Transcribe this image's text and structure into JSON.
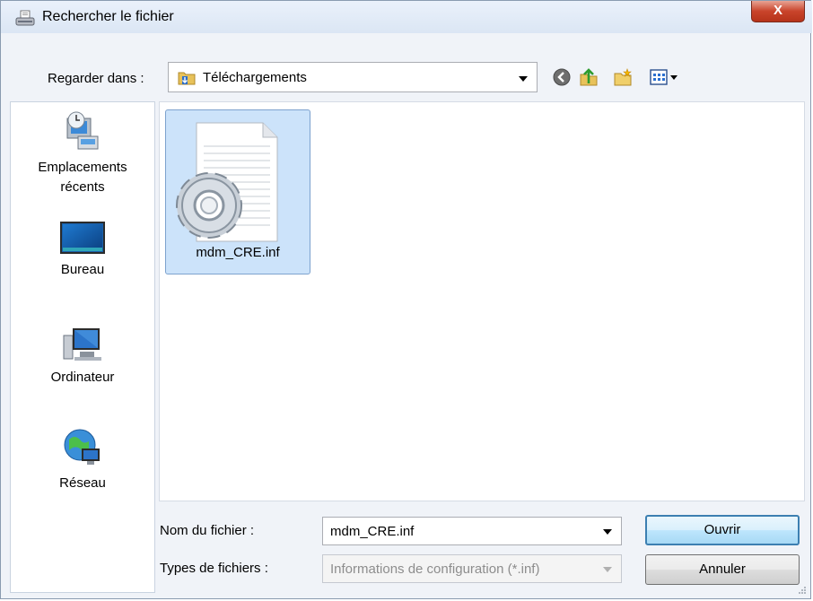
{
  "window": {
    "title": "Rechercher le fichier",
    "close_label": "X"
  },
  "lookin": {
    "label": "Regarder dans :",
    "value": "Téléchargements"
  },
  "toolbar": {
    "icons": [
      "back-icon",
      "up-folder-icon",
      "new-folder-icon",
      "view-menu-icon"
    ]
  },
  "places": [
    {
      "label_lines": [
        "Emplacements",
        "récents"
      ],
      "icon": "recent-places-icon"
    },
    {
      "label_lines": [
        "Bureau"
      ],
      "icon": "desktop-icon"
    },
    {
      "label_lines": [
        "Ordinateur"
      ],
      "icon": "computer-icon"
    },
    {
      "label_lines": [
        "Réseau"
      ],
      "icon": "network-icon"
    }
  ],
  "files": [
    {
      "name": "mdm_CRE.inf",
      "icon": "inf-settings-file-icon",
      "selected": true
    }
  ],
  "filename": {
    "label": "Nom du fichier :",
    "value": "mdm_CRE.inf"
  },
  "filetype": {
    "label": "Types de fichiers :",
    "value": "Informations de configuration (*.inf)",
    "disabled": true
  },
  "buttons": {
    "open": "Ouvrir",
    "cancel": "Annuler"
  },
  "colors": {
    "selection": "#cce3fa",
    "close_button": "#c9442b",
    "default_button_border": "#3c7fb1"
  }
}
